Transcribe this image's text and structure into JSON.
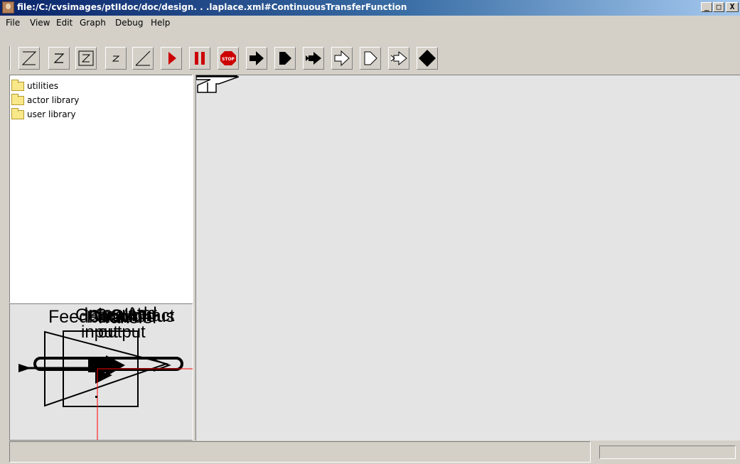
{
  "window": {
    "title": "file:/C:/cvsimages/ptIIdoc/doc/design. . .laplace.xml#ContinuousTransferFunction",
    "controls": {
      "minimize": "_",
      "maximize": "□",
      "close": "X"
    }
  },
  "menu": {
    "items": [
      "File",
      "View",
      "Edit",
      "Graph",
      "Debug",
      "Help"
    ]
  },
  "toolbar": {
    "buttons": [
      {
        "name": "zoom-reset-icon",
        "glyph": "Z"
      },
      {
        "name": "zoom-in-icon",
        "glyph": "Z"
      },
      {
        "name": "zoom-fit-icon",
        "glyph": "Z"
      },
      {
        "name": "zoom-out-icon",
        "glyph": "z"
      },
      {
        "name": "zoom-full-icon",
        "glyph": "Z"
      },
      {
        "name": "run-icon"
      },
      {
        "name": "pause-icon"
      },
      {
        "name": "stop-icon",
        "glyph": "STOP"
      },
      {
        "name": "new-port-icon"
      },
      {
        "name": "new-multiport-icon"
      },
      {
        "name": "new-input-port-icon"
      },
      {
        "name": "new-output-port-icon"
      },
      {
        "name": "new-input-multiport-icon"
      },
      {
        "name": "new-output-multiport-icon"
      },
      {
        "name": "new-relation-icon"
      }
    ],
    "colors": {
      "run": "#cc0000",
      "pause": "#cc0000",
      "stop": "#cc0000"
    }
  },
  "library": {
    "items": [
      {
        "label": "utilities",
        "icon": "folder-icon"
      },
      {
        "label": "actor library",
        "icon": "folder-icon"
      },
      {
        "label": "user library",
        "icon": "folder-icon"
      }
    ]
  },
  "panner": {
    "overlapping_labels": [
      "Feedback",
      "Gain",
      "Integrator",
      "Scale",
      "Add",
      "Subtract",
      "Continuous",
      "Transfer",
      "Function",
      "input",
      "output"
    ],
    "accent": "#ff0000"
  },
  "status": {
    "message": "",
    "progress": ""
  }
}
